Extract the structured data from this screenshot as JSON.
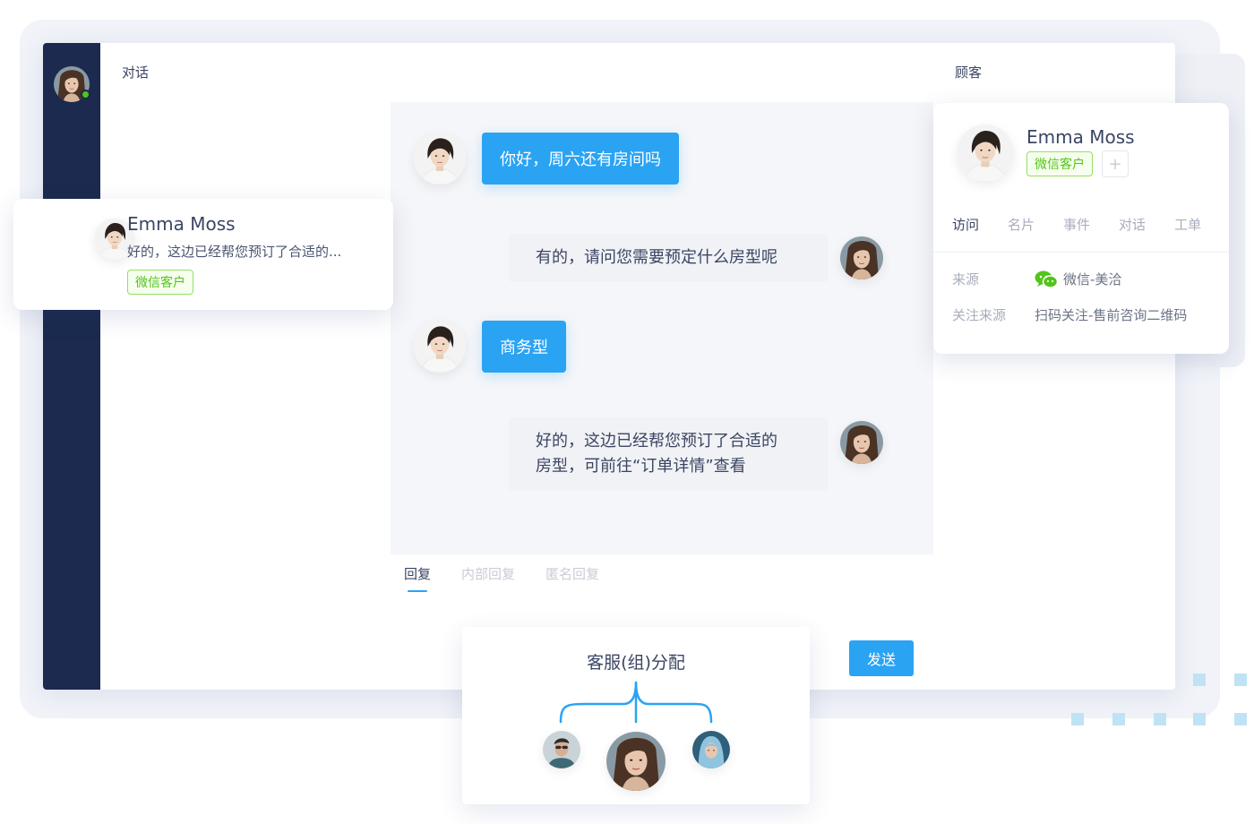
{
  "app": {
    "header_conversation": "对话",
    "header_customer": "顾客"
  },
  "conversation_card": {
    "name": "Emma Moss",
    "preview": "好的，这边已经帮您预订了合适的...",
    "tag": "微信客户"
  },
  "messages": [
    {
      "from": "customer",
      "text": "你好，周六还有房间吗"
    },
    {
      "from": "agent",
      "text": "有的，请问您需要预定什么房型呢"
    },
    {
      "from": "customer",
      "text": "商务型"
    },
    {
      "from": "agent",
      "line1": "好的，这边已经帮您预订了合适的",
      "line2": "房型，可前往“订单详情”查看"
    }
  ],
  "reply": {
    "tabs": [
      {
        "label": "回复",
        "active": true
      },
      {
        "label": "内部回复",
        "active": false
      },
      {
        "label": "匿名回复",
        "active": false
      }
    ],
    "send_label": "发送"
  },
  "customer_card": {
    "name": "Emma Moss",
    "tag": "微信客户",
    "add_tag": "+",
    "tabs": [
      "访问",
      "名片",
      "事件",
      "对话",
      "工单"
    ],
    "active_tab": "访问",
    "info": [
      {
        "label": "来源",
        "value": "微信-美洽",
        "icon": "wechat-icon"
      },
      {
        "label": "关注来源",
        "value": "扫码关注-售前咨询二维码"
      }
    ]
  },
  "assign_card": {
    "title": "客服(组)分配"
  },
  "colors": {
    "sidebar": "#1b2a4e",
    "accent": "#2aa3f3",
    "tag_green": "#52c41a",
    "online": "#52c41a"
  }
}
